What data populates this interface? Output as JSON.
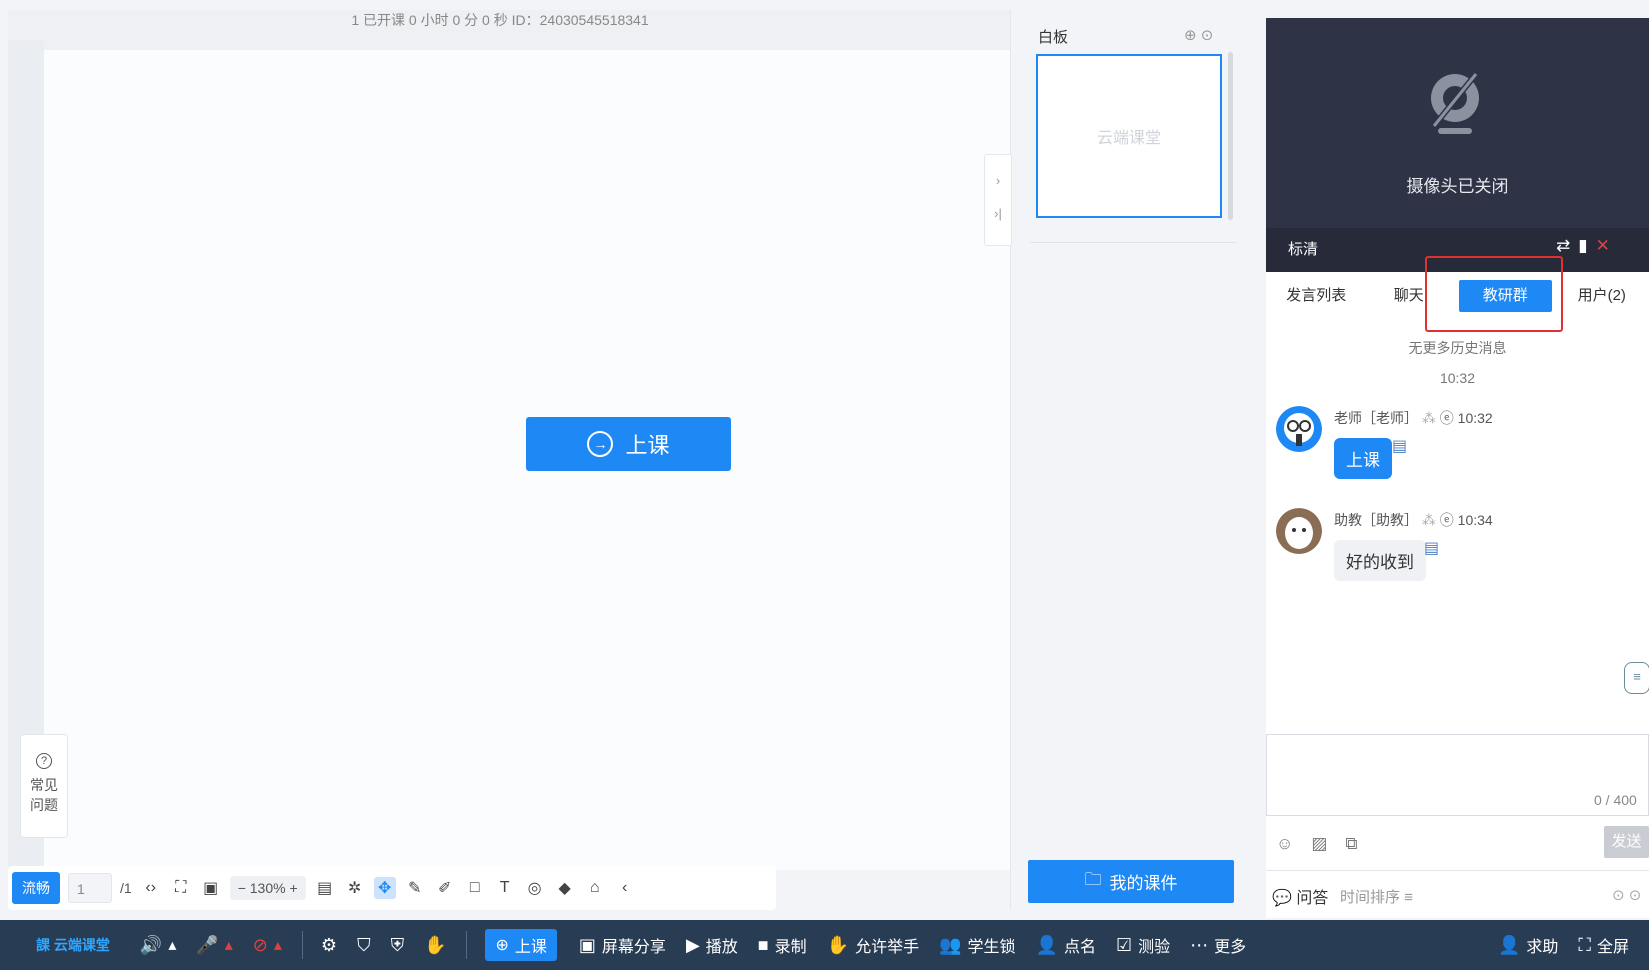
{
  "status": {
    "text": "1  已开课 0 小时 0 分 0 秒   ID：24030545518341"
  },
  "canvas": {
    "start_button": "上课"
  },
  "faq": {
    "label_line1": "常见",
    "label_line2": "问题"
  },
  "toolbar": {
    "quality": "流畅",
    "page_current": "1",
    "page_total": "/1",
    "zoom": "130%"
  },
  "thumbnails": {
    "title": "白板",
    "thumb_watermark": "云端课堂",
    "my_courseware": "我的课件"
  },
  "video": {
    "camera_off_text": "摄像头已关闭",
    "quality": "标清"
  },
  "tabs": [
    {
      "label": "发言列表",
      "active": false
    },
    {
      "label": "聊天",
      "active": false
    },
    {
      "label": "教研群",
      "active": true
    },
    {
      "label": "用户(2)",
      "active": false
    }
  ],
  "chat": {
    "no_more": "无更多历史消息",
    "time_marker": "10:32",
    "messages": [
      {
        "sender": "老师［老师］",
        "time": "10:32",
        "text": "上课",
        "role": "teacher"
      },
      {
        "sender": "助教［助教］",
        "time": "10:34",
        "text": "好的收到",
        "role": "ta"
      }
    ],
    "counter": "0 / 400",
    "send": "发送"
  },
  "qa": {
    "label": "问答",
    "sort": "时间排序"
  },
  "bottom_bar": {
    "logo": "云端课堂",
    "start": "上课",
    "screen_share": "屏幕分享",
    "play": "播放",
    "record": "录制",
    "raise_hand": "允许举手",
    "student_lock": "学生锁",
    "roll_call": "点名",
    "quiz": "测验",
    "more": "更多",
    "help": "求助",
    "fullscreen": "全屏"
  },
  "colors": {
    "accent": "#1e88f5",
    "bottom_bar": "#283c54",
    "video_bg": "#2e3345",
    "highlight": "#e03030"
  }
}
